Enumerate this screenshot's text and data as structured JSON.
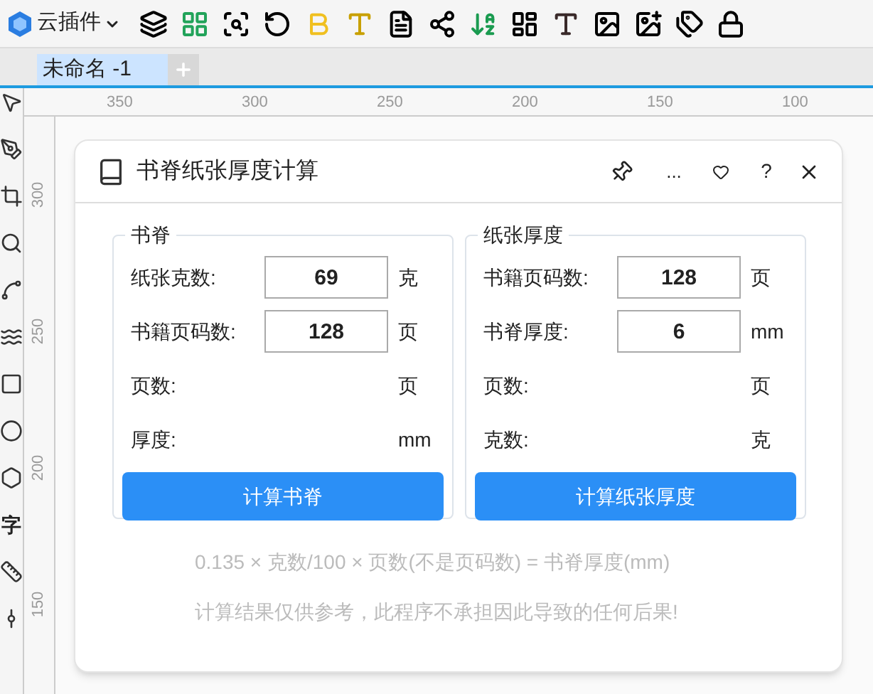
{
  "toolbar": {
    "menu": "云插件"
  },
  "document_tabs": [
    {
      "label": "未命名 -1",
      "selected": true
    }
  ],
  "ruler": {
    "horizontal": [
      "350",
      "300",
      "250",
      "200",
      "150",
      "100"
    ],
    "vertical": [
      "300",
      "250",
      "200",
      "150"
    ]
  },
  "toolbox": {
    "text_tool": "字"
  },
  "dialog": {
    "title": "书脊纸张厚度计算",
    "more": "...",
    "help": "?",
    "groups": [
      {
        "title": "书脊",
        "rows": [
          {
            "label": "纸张克数:",
            "value": "69",
            "unit": "克"
          },
          {
            "label": "书籍页码数:",
            "value": "128",
            "unit": "页"
          },
          {
            "label": "页数:",
            "unit": "页"
          },
          {
            "label": "厚度:",
            "unit": "mm"
          }
        ],
        "button": "计算书脊"
      },
      {
        "title": "纸张厚度",
        "rows": [
          {
            "label": "书籍页码数:",
            "value": "128",
            "unit": "页"
          },
          {
            "label": "书脊厚度:",
            "value": "6",
            "unit": "mm"
          },
          {
            "label": "页数:",
            "unit": "页"
          },
          {
            "label": "克数:",
            "unit": "克"
          }
        ],
        "button": "计算纸张厚度"
      }
    ],
    "notes": [
      "0.135 × 克数/100 × 页数(不是页码数) = 书脊厚度(mm)",
      "计算结果仅供参考，此程序不承担因此导致的任何后果!"
    ]
  }
}
